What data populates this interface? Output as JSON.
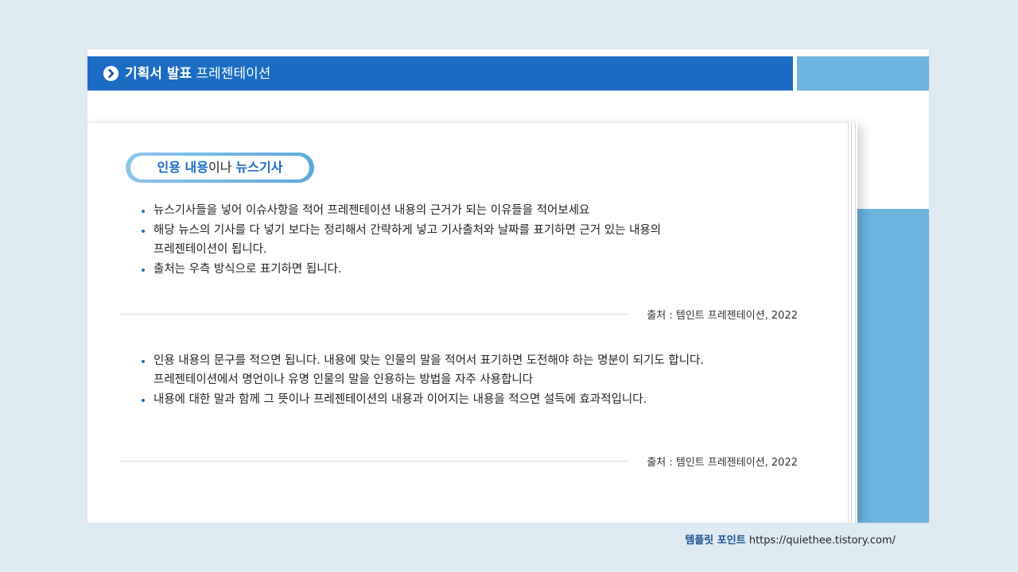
{
  "header": {
    "title_bold": "기획서 발표",
    "title_rest": "프레젠테이션",
    "icon": "chevron-right-circle-icon"
  },
  "pill": {
    "part1": "인용 내용",
    "part2": "이나",
    "part3": "뉴스기사"
  },
  "section1": {
    "bullets": [
      {
        "lines": [
          "뉴스기사들을 넣어 이슈사항을 적어 프레젠테이션 내용의 근거가 되는 이유들을 적어보세요"
        ]
      },
      {
        "lines": [
          "해당 뉴스의 기사를 다 넣기 보다는 정리해서 간략하게 넣고 기사출처와 날짜를 표기하면 근거 있는 내용의",
          "프레젠테이션이 됩니다."
        ]
      },
      {
        "lines": [
          "출처는 우측 방식으로 표기하면 됩니다."
        ]
      }
    ],
    "source": "출처 : 템인트 프레젠테이션, 2022"
  },
  "section2": {
    "bullets": [
      {
        "lines": [
          "인용 내용의 문구를 적으면 됩니다. 내용에 맞는 인물의 말을 적어서 표기하면 도전해야 하는 명분이 되기도 합니다.",
          "프레젠테이션에서 명언이나 유명 인물의 말을 인용하는 방법을 자주 사용합니다"
        ]
      },
      {
        "lines": [
          "내용에 대한 말과 함께 그 뜻이나 프레젠테이션의 내용과 이어지는 내용을 적으면 설득에 효과적입니다."
        ]
      }
    ],
    "source": "출처 : 템인트 프레젠테이션, 2022"
  },
  "footer": {
    "brand": "템플릿 포인트",
    "url": "https://quiethee.tistory.com/"
  },
  "colors": {
    "primary": "#1b6cc3",
    "accent": "#6cb3df",
    "background": "#deebf3"
  }
}
